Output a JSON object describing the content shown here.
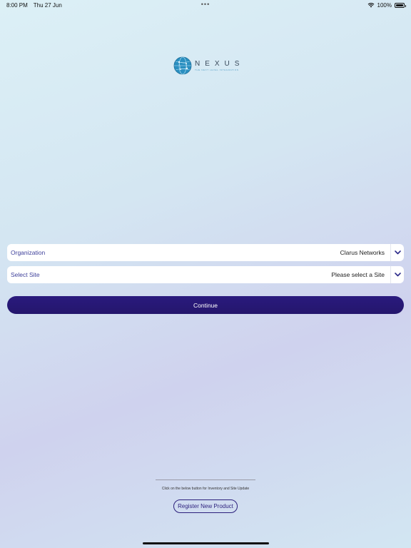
{
  "status_bar": {
    "time": "8:00 PM",
    "date": "Thu 27 Jun",
    "dots": "•••",
    "battery": "100%",
    "wifi_icon": "wifi-icon",
    "battery_icon": "battery-icon"
  },
  "logo": {
    "word": "NEXUS",
    "tagline": "THE NEXT LEVEL INTEGRATION"
  },
  "form": {
    "organization": {
      "label": "Organization",
      "value": "Clarus Networks"
    },
    "site": {
      "label": "Select Site",
      "value": "Please select a Site"
    },
    "continue_label": "Continue"
  },
  "footer": {
    "hint": "Click on the below button for Inventory and Site Update",
    "register_label": "Register New Product"
  },
  "colors": {
    "accent": "#2a1a7e",
    "label": "#3d3f9a",
    "globe": "#2a8fc0"
  }
}
